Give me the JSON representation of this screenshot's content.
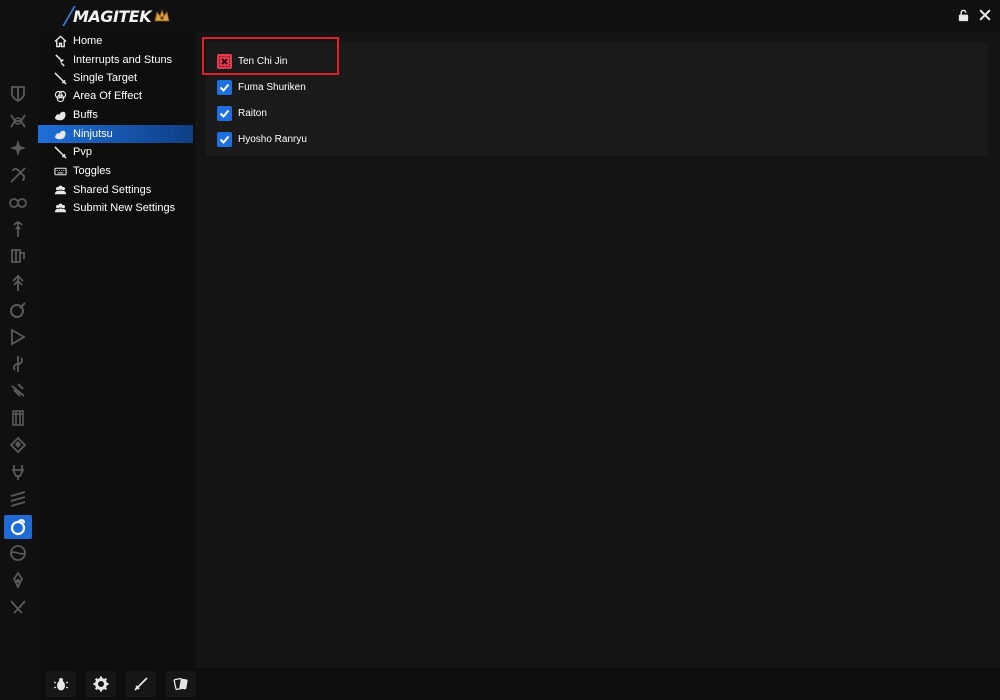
{
  "app": {
    "logo_text": "MAGITEK",
    "accent": "#1e6fd6"
  },
  "titlebar": {
    "icons": [
      "lock-icon",
      "close-icon"
    ]
  },
  "rail": {
    "items": [
      "paladin-icon",
      "warrior-icon",
      "darkknight-icon",
      "gunbreaker-icon",
      "monk-icon",
      "dragoon-icon",
      "samurai-icon",
      "reaper-icon",
      "bard-icon",
      "machinist-icon",
      "dancer-icon",
      "blackmage-icon",
      "summoner-icon",
      "redmage-icon",
      "whitemage-icon",
      "scholar-icon",
      "astrologian-icon",
      "ninja-icon",
      "sage-icon",
      "viper-icon",
      "pictomancer-icon"
    ],
    "active": "ninja-icon"
  },
  "nav": {
    "items": [
      {
        "label": "Home",
        "icon": "home-icon"
      },
      {
        "label": "Interrupts and Stuns",
        "icon": "dagger-icon"
      },
      {
        "label": "Single Target",
        "icon": "sword-icon"
      },
      {
        "label": "Area Of Effect",
        "icon": "aoe-icon"
      },
      {
        "label": "Buffs",
        "icon": "muscle-icon"
      },
      {
        "label": "Ninjutsu",
        "icon": "muscle-icon"
      },
      {
        "label": "Pvp",
        "icon": "sword-icon"
      },
      {
        "label": "Toggles",
        "icon": "keyboard-icon"
      },
      {
        "label": "Shared Settings",
        "icon": "users-icon"
      },
      {
        "label": "Submit New Settings",
        "icon": "users-icon"
      }
    ],
    "active": "Ninjutsu"
  },
  "options": [
    {
      "label": "Ten Chi Jin",
      "checked": false
    },
    {
      "label": "Fuma Shuriken",
      "checked": true
    },
    {
      "label": "Raiton",
      "checked": true
    },
    {
      "label": "Hyosho Ranryu",
      "checked": true
    }
  ],
  "bottombar": {
    "buttons": [
      "bug-icon",
      "gear-icon",
      "sword-icon",
      "cards-icon"
    ]
  }
}
